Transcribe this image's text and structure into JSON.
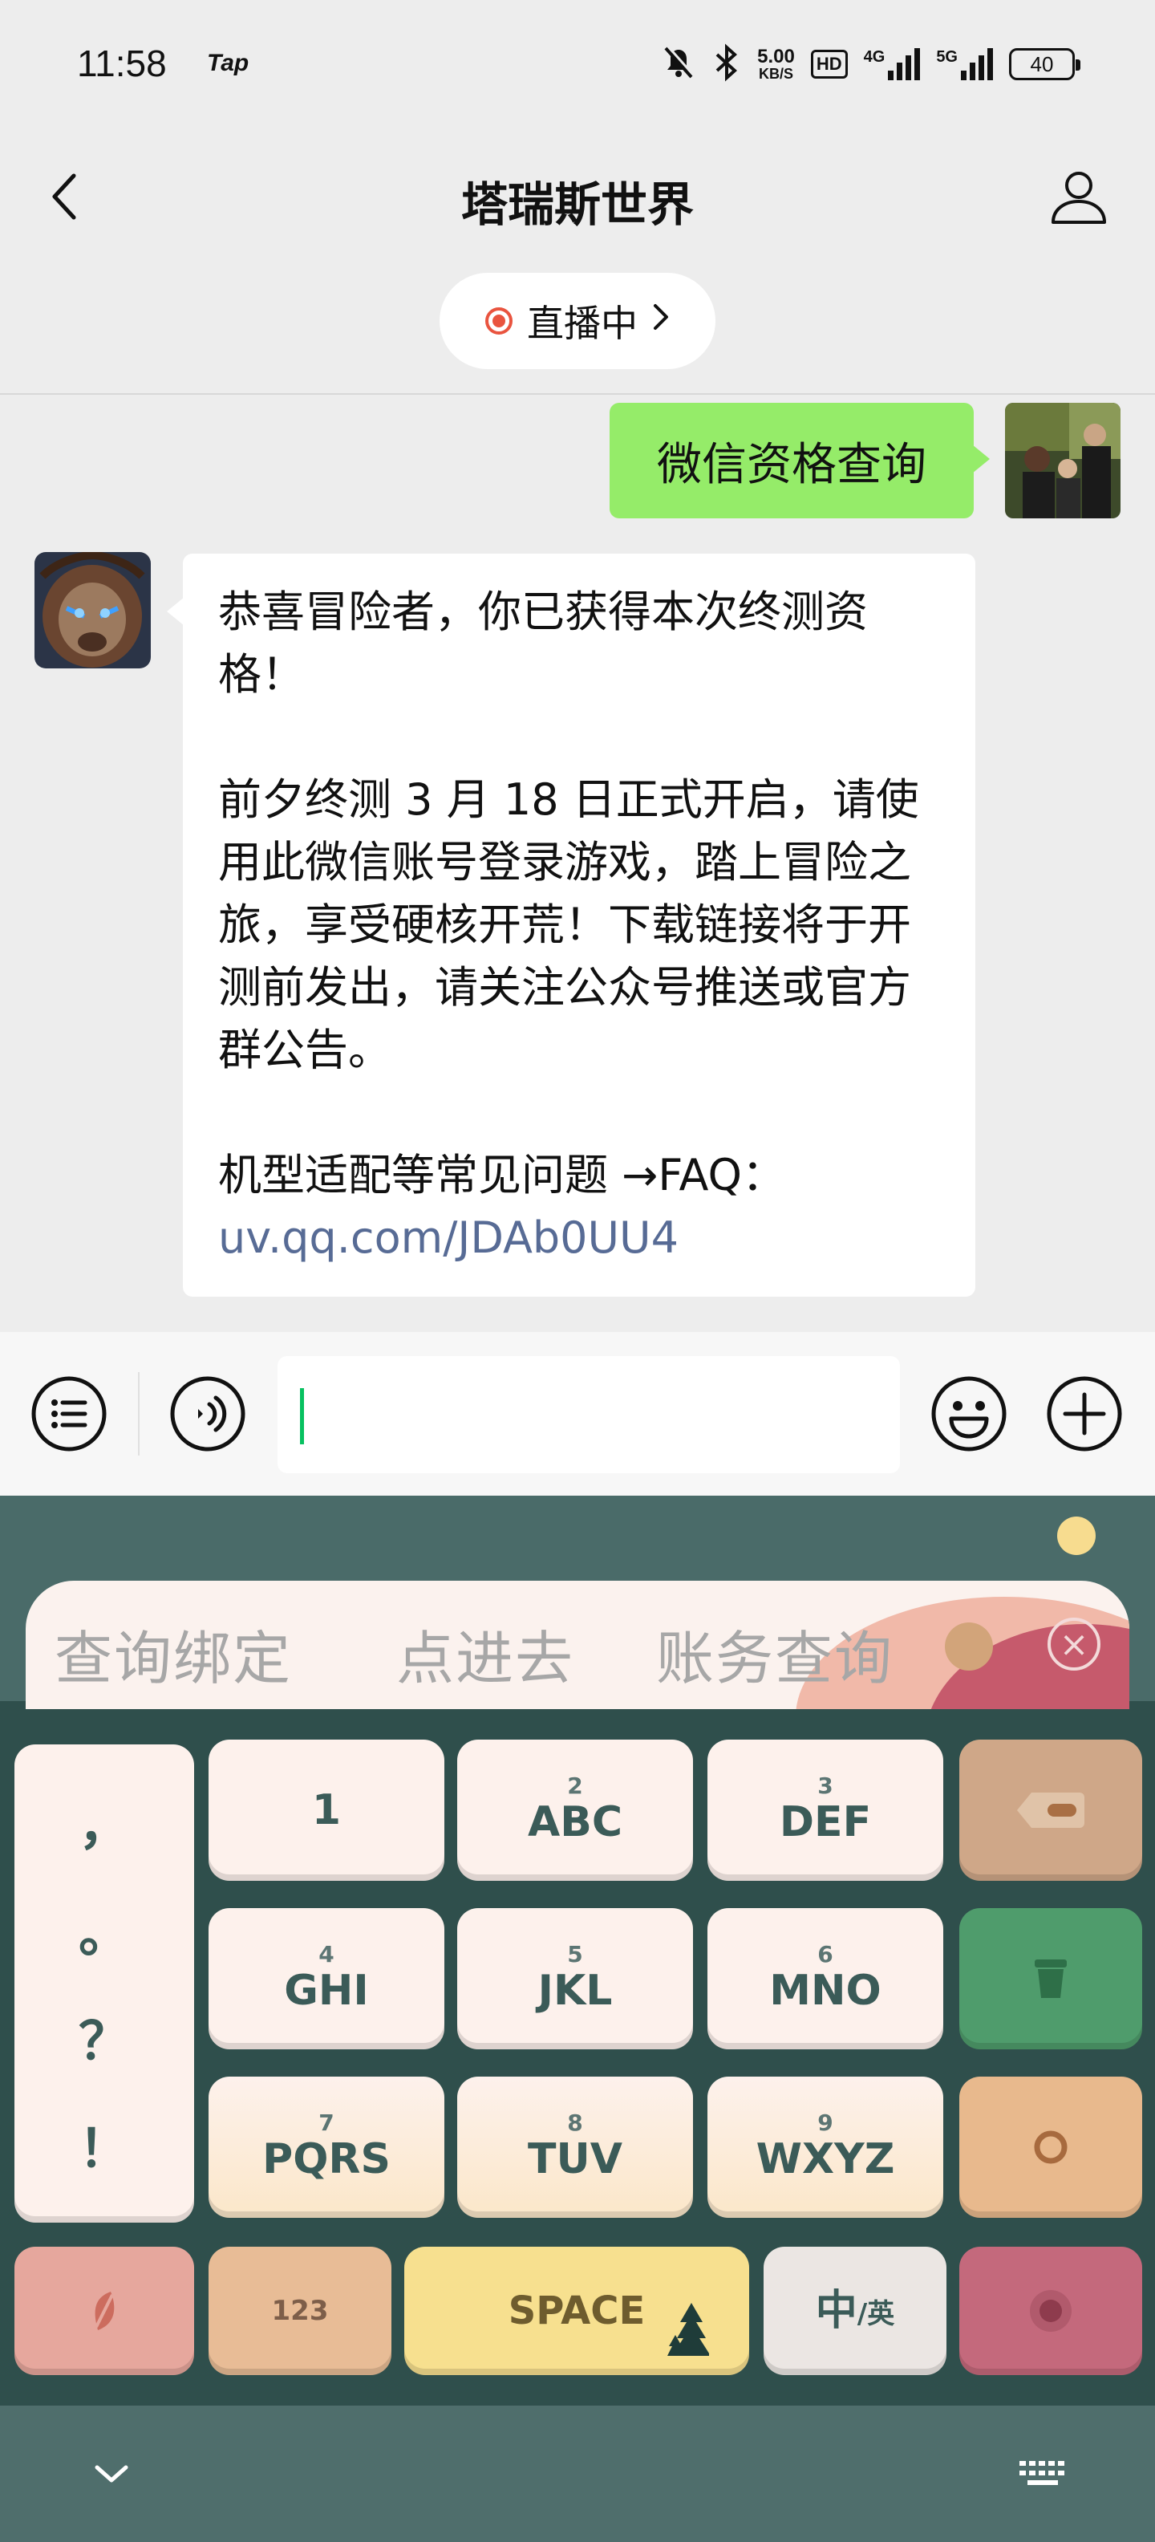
{
  "status_bar": {
    "time": "11:58",
    "app_badge": "Tap",
    "net_speed": "5.00",
    "net_speed_unit": "KB/S",
    "hd_badge": "HD",
    "sim1_label": "4G",
    "sim2_label": "5G",
    "battery": "40"
  },
  "header": {
    "title": "塔瑞斯世界",
    "live_label": "直播中"
  },
  "messages": {
    "outgoing": "微信资格查询",
    "incoming": {
      "p1": "恭喜冒险者，你已获得本次终测资格！",
      "p2": "前夕终测 3 月 18 日正式开启，请使用此微信账号登录游戏，踏上冒险之旅，享受硬核开荒！下载链接将于开测前发出，请关注公众号推送或官方群公告。",
      "p3_prefix": "机型适配等常见问题 →FAQ：",
      "p3_link": "uv.qq.com/JDAb0UU4"
    }
  },
  "input": {
    "value": ""
  },
  "keyboard": {
    "candidates": [
      "查询绑定",
      "点进去",
      "账务查询"
    ],
    "punctuation": [
      "，",
      "。",
      "？",
      "！"
    ],
    "keys": {
      "k1": {
        "num": "",
        "label": "1"
      },
      "k2": {
        "num": "2",
        "label": "ABC"
      },
      "k3": {
        "num": "3",
        "label": "DEF"
      },
      "k4": {
        "num": "4",
        "label": "GHI"
      },
      "k5": {
        "num": "5",
        "label": "JKL"
      },
      "k6": {
        "num": "6",
        "label": "MNO"
      },
      "k7": {
        "num": "7",
        "label": "PQRS"
      },
      "k8": {
        "num": "8",
        "label": "TUV"
      },
      "k9": {
        "num": "9",
        "label": "WXYZ"
      }
    },
    "bottom_row": {
      "numeric": "123",
      "space": "SPACE",
      "lang_main": "中",
      "lang_sub": "/英"
    },
    "colors": {
      "background": "#2f4f4c",
      "key_light": "#fdf1ec",
      "backspace": "#cfa788",
      "clear": "#4f9c6c",
      "enter": "#e8b98d",
      "emoji": "#e6a79d",
      "numeric": "#e8bc96",
      "space": "#f7e08f",
      "lang": "#ebe6e3",
      "voice": "#c4697c"
    }
  },
  "colors": {
    "sent_bubble": "#95ec69",
    "link": "#576b95",
    "live_dot": "#e9543f"
  }
}
